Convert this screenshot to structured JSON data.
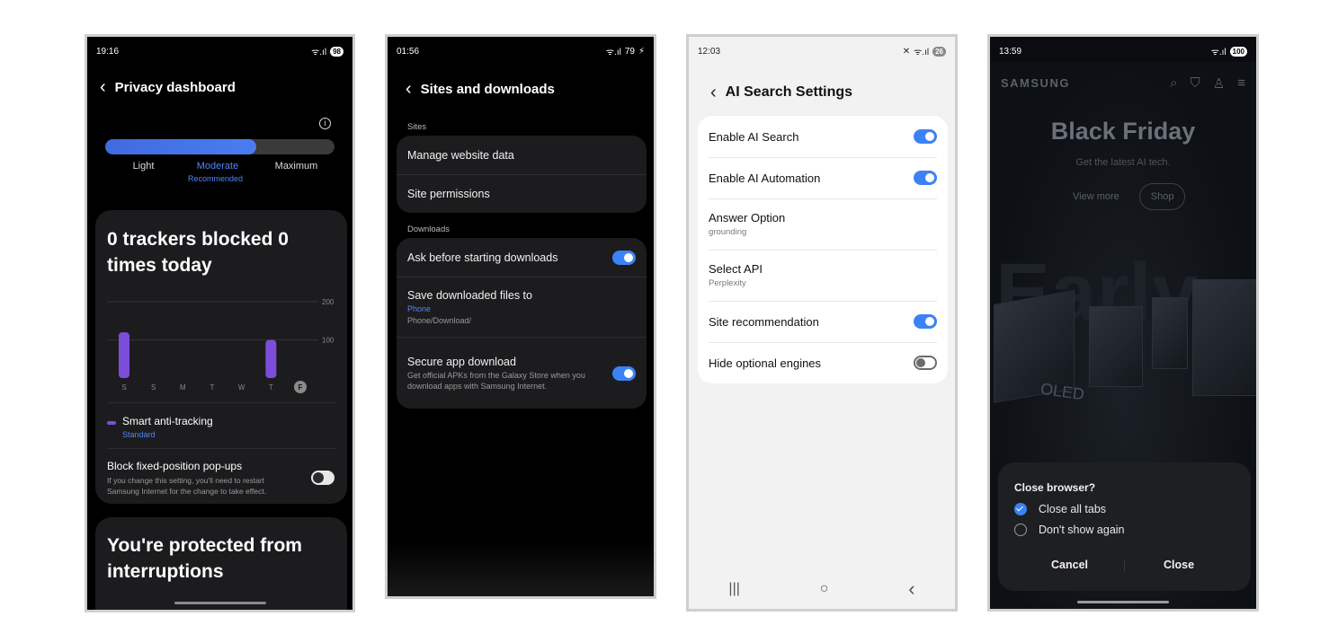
{
  "phone1": {
    "status": {
      "time": "19:16",
      "battery": "98"
    },
    "title": "Privacy dashboard",
    "levels": [
      "Light",
      "Moderate",
      "Maximum"
    ],
    "selected_level": "Moderate",
    "recommended": "Recommended",
    "protection_level_fraction": 0.66,
    "trackers_text": "0 trackers blocked 0 times today",
    "chart_data": {
      "type": "bar",
      "categories": [
        "S",
        "S",
        "M",
        "T",
        "W",
        "T",
        "F"
      ],
      "values": [
        120,
        0,
        0,
        0,
        0,
        100,
        0
      ],
      "y_ticks": [
        100,
        200
      ],
      "ylim": [
        0,
        240
      ],
      "highlight": "F"
    },
    "smart_anti_tracking": {
      "label": "Smart anti-tracking",
      "value": "Standard"
    },
    "block_popups": {
      "label": "Block fixed-position pop-ups",
      "desc": "If you change this setting, you'll need to restart Samsung Internet for the change to take effect.",
      "enabled": false
    },
    "protected_text": "You're protected from interruptions"
  },
  "phone2": {
    "status": {
      "time": "01:56",
      "battery": "79"
    },
    "title": "Sites and downloads",
    "sites_header": "Sites",
    "sites_items": [
      "Manage website data",
      "Site permissions"
    ],
    "downloads_header": "Downloads",
    "ask_before": {
      "label": "Ask before starting downloads",
      "enabled": true
    },
    "save_to": {
      "label": "Save downloaded files to",
      "value": "Phone",
      "path": "Phone/Download/"
    },
    "secure_download": {
      "label": "Secure app download",
      "desc": "Get official APKs from the Galaxy Store when you download apps with Samsung Internet.",
      "enabled": true
    }
  },
  "phone3": {
    "status": {
      "time": "12:03",
      "battery": "26"
    },
    "title": "AI Search Settings",
    "items": [
      {
        "label": "Enable AI Search",
        "toggle": true,
        "on": true
      },
      {
        "label": "Enable AI Automation",
        "toggle": true,
        "on": true
      },
      {
        "label": "Answer Option",
        "sub": "grounding",
        "toggle": false
      },
      {
        "label": "Select API",
        "sub": "Perplexity",
        "toggle": false
      },
      {
        "label": "Site recommendation",
        "toggle": true,
        "on": true
      },
      {
        "label": "Hide optional engines",
        "toggle": true,
        "on": false
      }
    ],
    "nav": {
      "recents": "|||",
      "home": "○",
      "back": "‹"
    }
  },
  "phone4": {
    "status": {
      "time": "13:59",
      "battery": "100"
    },
    "brand": "SAMSUNG",
    "headline": "Black Friday",
    "subline": "Get the latest AI tech.",
    "view_more": "View more",
    "shop": "Shop",
    "bg_word": "Early",
    "oled": "OLED",
    "dialog": {
      "question": "Close browser?",
      "option1": "Close all tabs",
      "option1_checked": true,
      "option2": "Don't show again",
      "option2_checked": false,
      "cancel": "Cancel",
      "close": "Close"
    }
  },
  "colors": {
    "accent": "#3b82f6",
    "bar": "#7c4dd8",
    "dark_card": "#1c1c1e"
  }
}
